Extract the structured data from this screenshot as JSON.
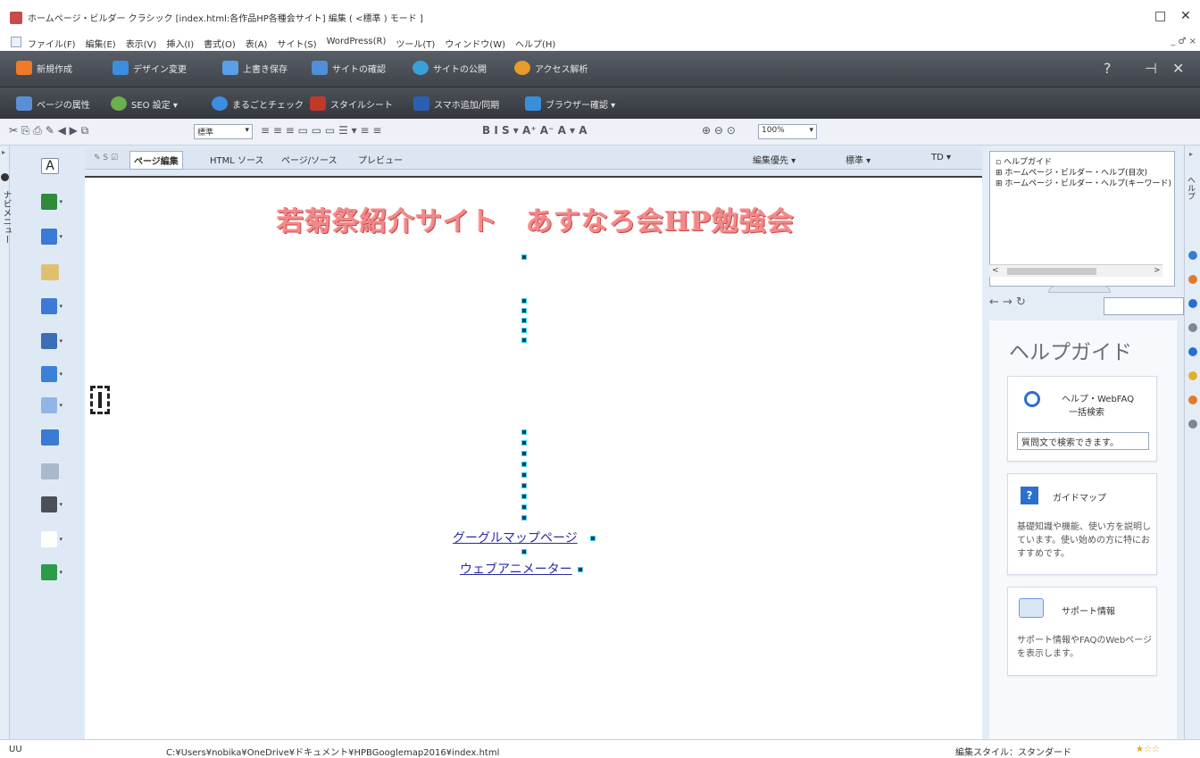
{
  "window": {
    "title": "ホームページ・ビルダー クラシック [index.html:各作品HP各種会サイト] 編集 ( <標準 ) モード ]",
    "min_glyph": "□",
    "close_glyph": "✕"
  },
  "menubar": {
    "items": [
      "ファイル(F)",
      "編集(E)",
      "表示(V)",
      "挿入(I)",
      "書式(O)",
      "表(A)",
      "サイト(S)",
      "WordPress(R)",
      "ツール(T)",
      "ウィンドウ(W)",
      "ヘルプ(H)"
    ],
    "mdi_controls": "_ ♂ ×"
  },
  "toolbar_main": {
    "items": [
      "新規作成",
      "デザイン変更",
      "上書き保存",
      "サイトの確認",
      "サイトの公開",
      "アクセス解析"
    ],
    "help_glyph": "?",
    "pin_glyph": "⊣",
    "close_glyph": "✕",
    "colors": [
      "#f07a2a",
      "#3c8ee0",
      "#5aa0e8",
      "#4f8fd8",
      "#3aa0d8",
      "#e89a2a"
    ]
  },
  "toolbar_sub": {
    "items": [
      "ページの属性",
      "SEO 設定 ▾",
      "まるごとチェック",
      "スタイルシート",
      "スマホ追加/同期",
      "ブラウザー確認 ▾"
    ],
    "colors": [
      "#5a8fd6",
      "#6ab04c",
      "#3c8ee0",
      "#c0392b",
      "#2b5fb0",
      "#3a8fd8"
    ]
  },
  "format_bar": {
    "left_glyphs": "✂  ⎘  ⎙  ✎  ◀  ▶  ⧉",
    "paragraph_style": "標準",
    "align_glyphs": "≡  ≡  ≡   ▭  ▭  ▭   ☰ ▾  ≡  ≡",
    "text_glyphs": "B  I  S ▾  A⁺  A⁻  A ▾  A",
    "zoom_glyphs": "⊕  ⊖  ⊙",
    "zoom": "100%"
  },
  "left_rail": {
    "arrow_glyph": "▸",
    "label": "ナビメニュー"
  },
  "palette": {
    "first_glyph": "A",
    "caret_glyph": "▾",
    "colors": [
      "#ffffff",
      "#2d8b3a",
      "#3a7bd5",
      "#e0c070",
      "#3b7bd4",
      "#3b6fb5",
      "#3a82d8",
      "#8fb6e6",
      "#3a7bd5",
      "#aab8cc",
      "#4b4f57",
      "#ffffff",
      "#2d9b4a"
    ]
  },
  "editor": {
    "tab_icons": "✎ S ☑",
    "tabs": [
      "ページ編集",
      "HTML ソース",
      "ページ/ソース",
      "プレビュー"
    ],
    "right_controls": [
      "編集優先 ▾",
      "標準 ▾",
      "TD ▾"
    ],
    "heading": "若菊祭紹介サイト　あすなろ会HP勉強会",
    "links": [
      "グーグルマップページ",
      "ウェブアニメーター"
    ]
  },
  "help_panel": {
    "tree": [
      "ヘルプガイド",
      "ホームページ・ビルダー・ヘルプ(目次)",
      "ホームページ・ビルダー・ヘルプ(キーワード)"
    ],
    "tree_glyphs": [
      "▫",
      "⊞",
      "⊞"
    ],
    "scroll_left": "<",
    "scroll_right": ">",
    "nav_glyphs": "← → ↻",
    "title": "ヘルプガイド",
    "search_card": {
      "title": "ヘルプ・WebFAQ",
      "subtitle": "一括検索",
      "placeholder": "質問文で検索できます。"
    },
    "guide_card": {
      "badge": "?",
      "title": "ガイドマップ",
      "desc": "基礎知識や機能、使い方を説明しています。使い始めの方に特におすすめです。"
    },
    "support_card": {
      "title": "サポート情報",
      "desc": "サポート情報やFAQのWebページを表示します。"
    }
  },
  "right_strip": {
    "arrow_glyph": "▸",
    "label": "ヘルプ",
    "colors": [
      "#3a7bd5",
      "#e07a2a",
      "#2a6fd0",
      "#7a8896",
      "#2a6fd0",
      "#e0b030",
      "#e07a2a",
      "#7a8896"
    ]
  },
  "statusbar": {
    "mode": "UU",
    "path": "C:¥Users¥nobika¥OneDrive¥ドキュメント¥HPBGooglemap2016¥index.html",
    "style": "編集スタイル：スタンダード",
    "rating_glyphs": "★☆☆",
    "star_color": "#e8a020"
  }
}
